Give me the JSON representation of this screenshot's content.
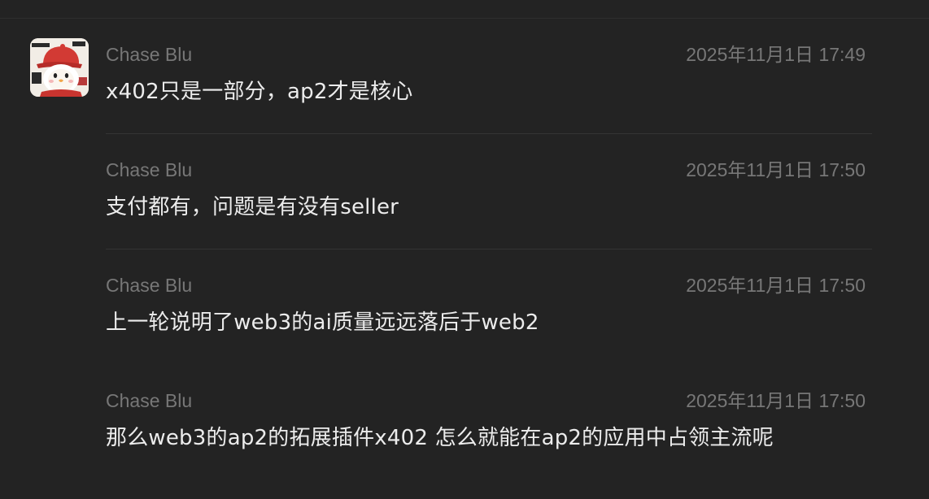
{
  "messages": [
    {
      "sender": "Chase Blu",
      "timestamp": "2025年11月1日 17:49",
      "text": "x402只是一部分，ap2才是核心",
      "has_avatar": true
    },
    {
      "sender": "Chase Blu",
      "timestamp": "2025年11月1日 17:50",
      "text": "支付都有，问题是有没有seller",
      "has_avatar": false
    },
    {
      "sender": "Chase Blu",
      "timestamp": "2025年11月1日 17:50",
      "text": "上一轮说明了web3的ai质量远远落后于web2",
      "has_avatar": false
    },
    {
      "sender": "Chase Blu",
      "timestamp": "2025年11月1日 17:50",
      "text": "那么web3的ap2的拓展插件x402 怎么就能在ap2的应用中占领主流呢",
      "has_avatar": false
    }
  ],
  "colors": {
    "background": "#232323",
    "meta_text": "#777777",
    "message_text": "#ececec",
    "divider": "#343434"
  },
  "avatar_icon": "penguin-red-cap-avatar"
}
